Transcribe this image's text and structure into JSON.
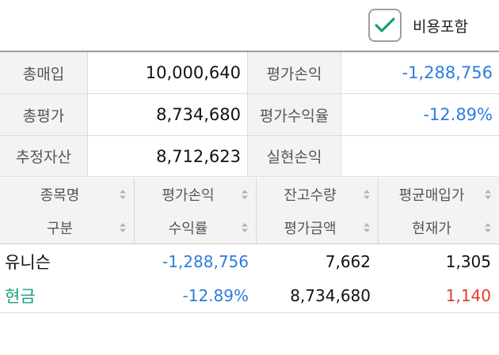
{
  "options": {
    "include_cost_label": "비용포함",
    "include_cost_checked": true
  },
  "summary": {
    "rows": [
      {
        "label": "총매입",
        "value": "10,000,640",
        "label2": "평가손익",
        "value2": "-1,288,756"
      },
      {
        "label": "총평가",
        "value": "8,734,680",
        "label2": "평가수익율",
        "value2": "-12.89%"
      },
      {
        "label": "추정자산",
        "value": "8,712,623",
        "label2": "실현손익",
        "value2": ""
      }
    ]
  },
  "table": {
    "header1": [
      "종목명",
      "평가손익",
      "잔고수량",
      "평균매입가"
    ],
    "header2": [
      "구분",
      "수익률",
      "평가금액",
      "현재가"
    ],
    "rows": [
      {
        "c1": "유니슨",
        "c2": "-1,288,756",
        "c3": "7,662",
        "c4": "1,305"
      },
      {
        "c1": "현금",
        "c2": "-12.89%",
        "c3": "8,734,680",
        "c4": "1,140"
      }
    ]
  },
  "colors": {
    "accent_teal": "#17a07a",
    "loss_blue": "#2b7de0",
    "price_red": "#e03b2a"
  }
}
